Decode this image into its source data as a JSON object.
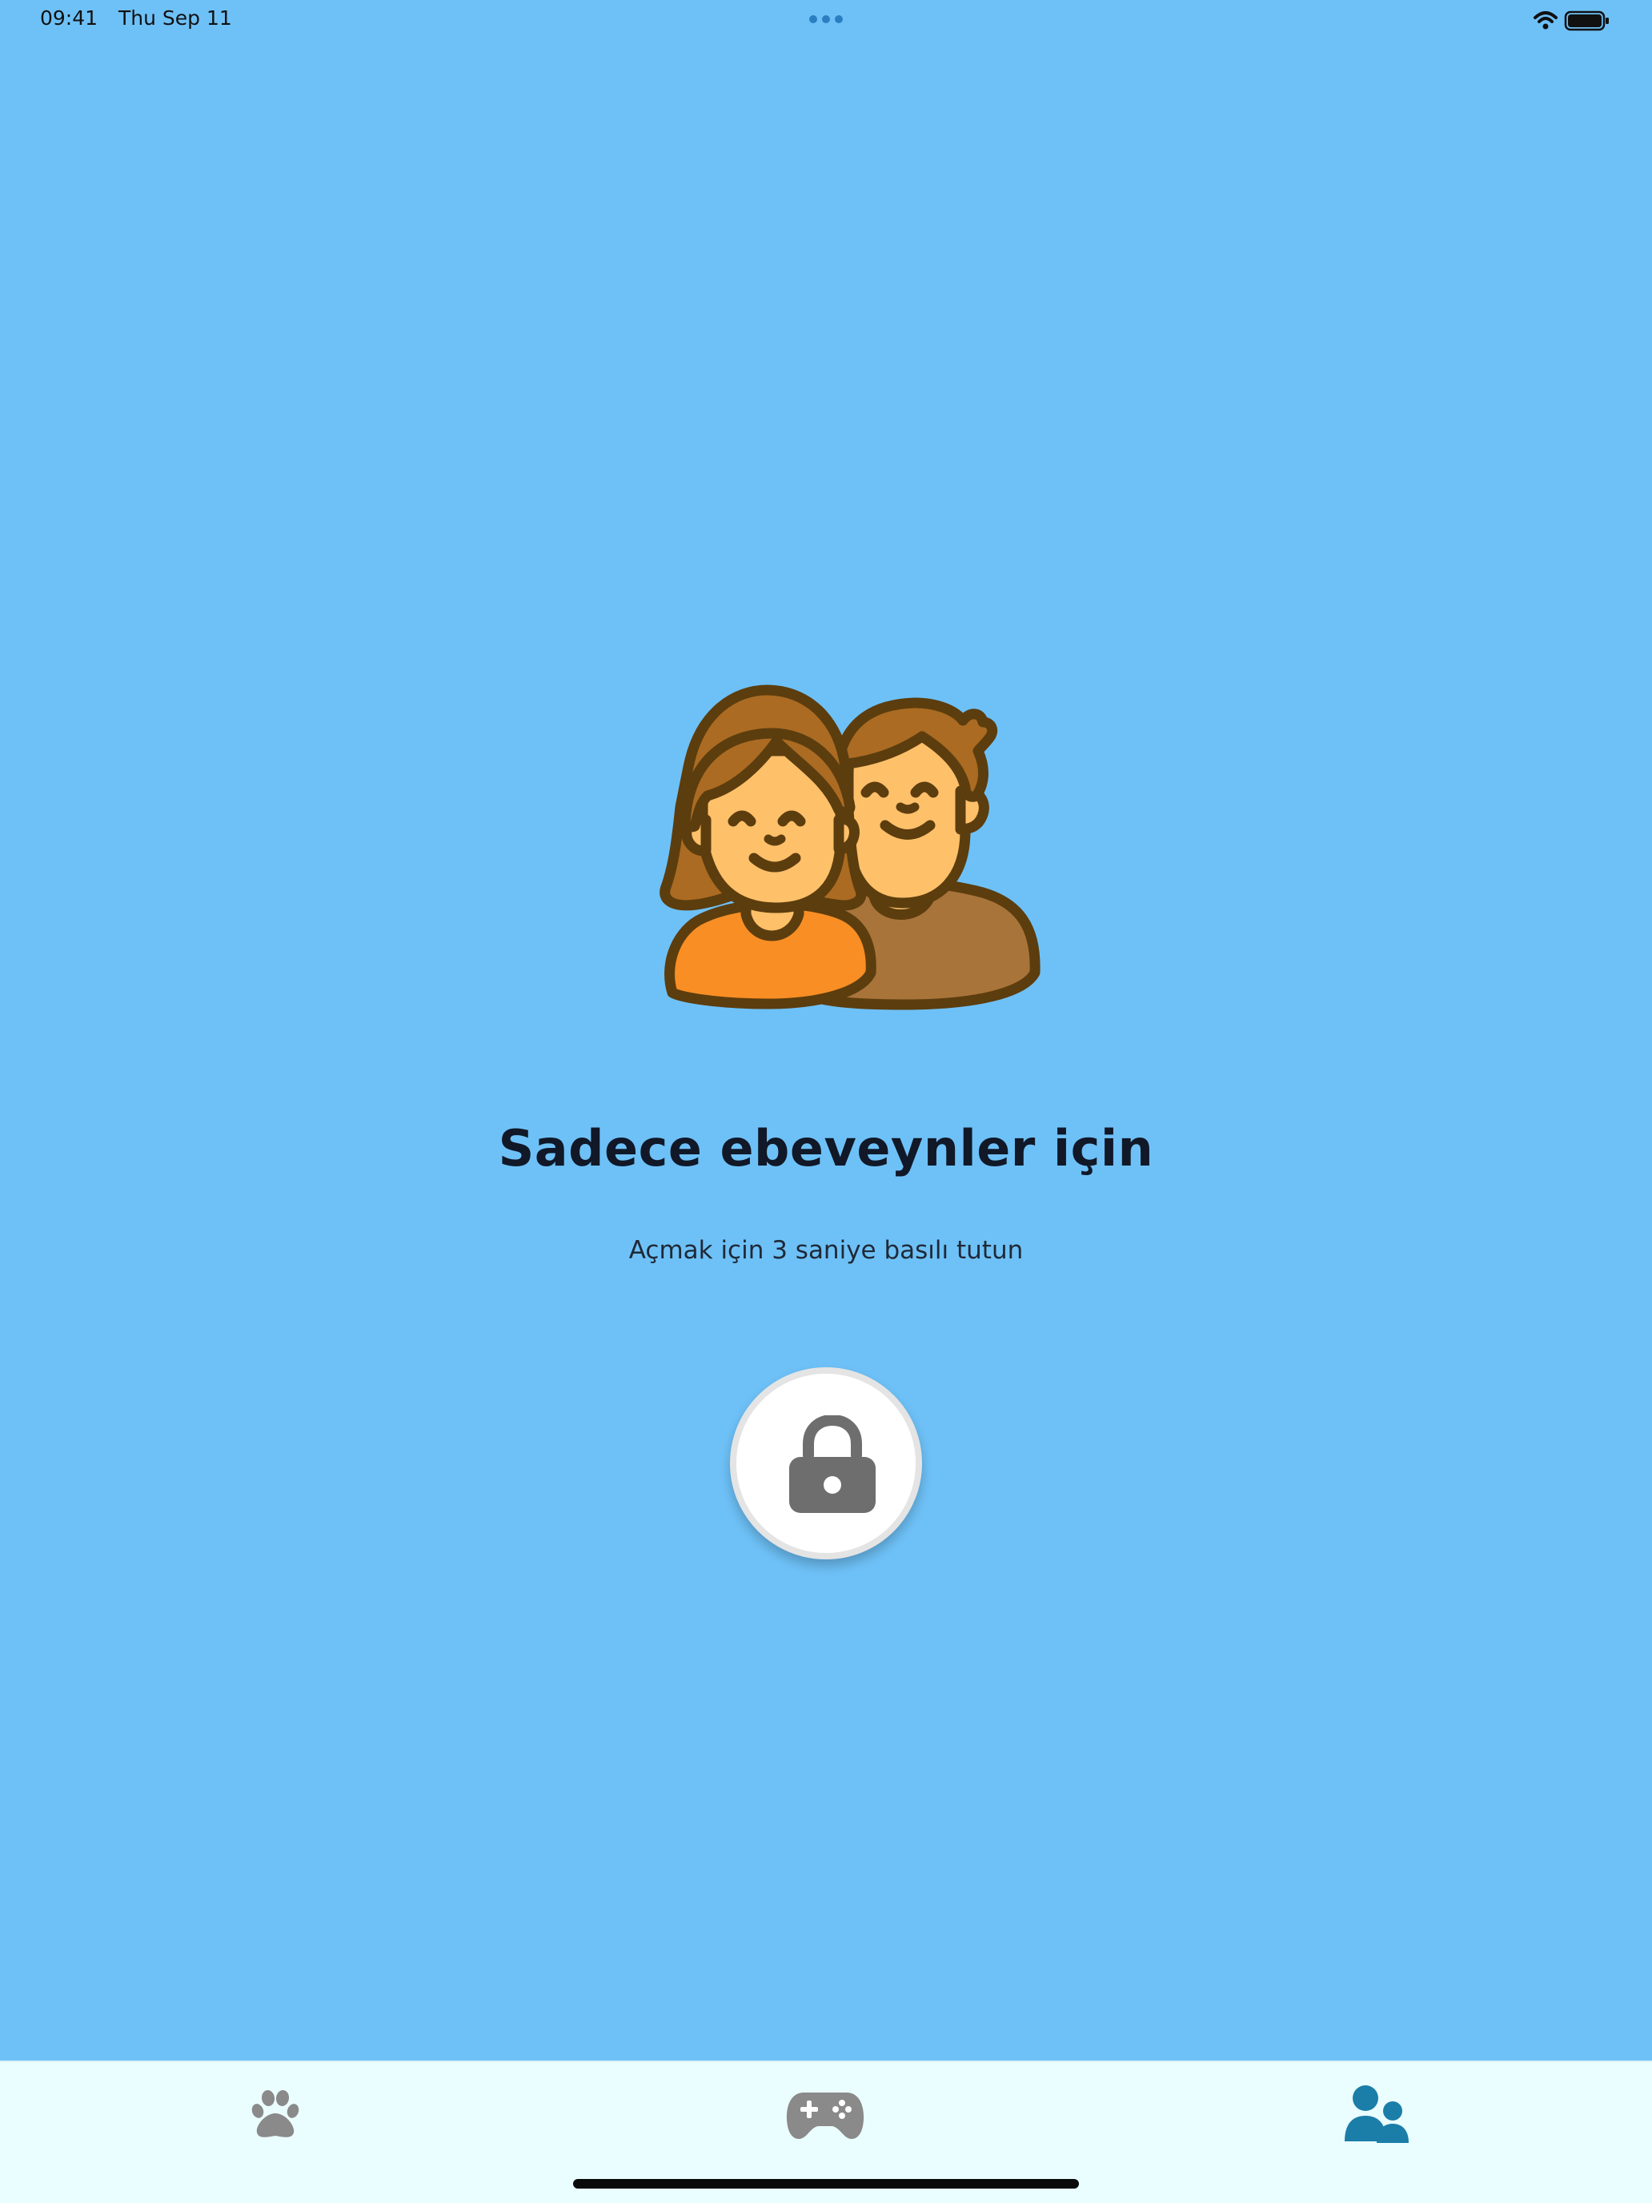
{
  "status_bar": {
    "time": "09:41",
    "date": "Thu Sep 11",
    "icons": [
      "more-dots-icon",
      "wifi-icon",
      "battery-icon"
    ]
  },
  "parents_screen": {
    "illustration": "two-people-avatar-icon",
    "title": "Sadece ebeveynler için",
    "subtitle": "Açmak için 3 saniye basılı tutun",
    "lock_button_icon": "lock-icon"
  },
  "tab_bar": {
    "tabs": [
      {
        "icon": "paw-icon",
        "selected": false
      },
      {
        "icon": "gamepad-icon",
        "selected": false
      },
      {
        "icon": "parents-icon",
        "selected": true
      }
    ]
  },
  "colors": {
    "background": "#6ec1f7",
    "tab_bar_background": "#ebfeff",
    "title_text": "#111827",
    "lock_icon": "#6e6e6e",
    "tab_inactive": "#8a8a8a",
    "tab_active": "#1a7ea8",
    "illustration_outline": "#5c3d0e",
    "illustration_skin": "#ffc06a",
    "illustration_hair": "#ab6b22",
    "illustration_orange_shirt": "#f88e24",
    "illustration_brown_shirt": "#a8743a"
  }
}
